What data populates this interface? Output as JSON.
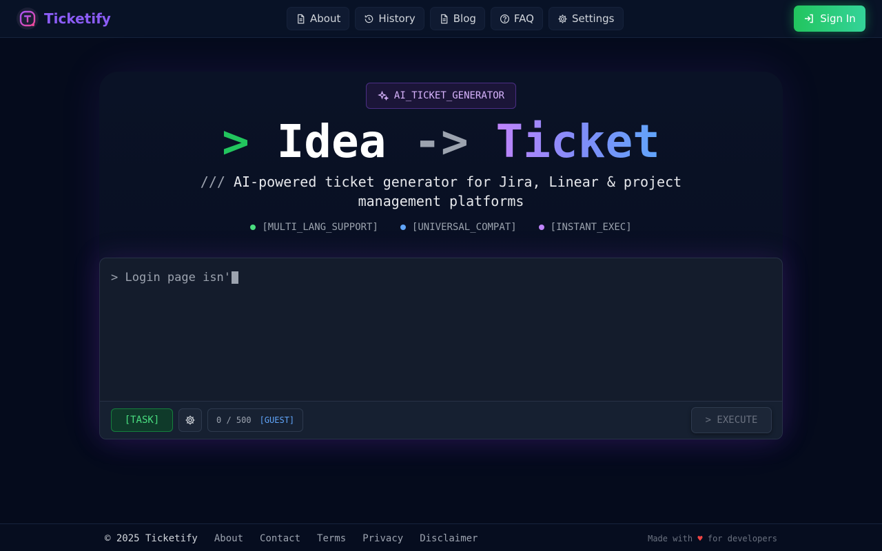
{
  "header": {
    "brand_name": "Ticketify",
    "nav": [
      {
        "label": "About",
        "icon": "file-icon"
      },
      {
        "label": "History",
        "icon": "history-icon"
      },
      {
        "label": "Blog",
        "icon": "file-icon"
      },
      {
        "label": "FAQ",
        "icon": "help-icon"
      },
      {
        "label": "Settings",
        "icon": "gear-icon"
      }
    ],
    "signin_label": "Sign In"
  },
  "hero": {
    "badge": "AI_TICKET_GENERATOR",
    "title_prompt": ">",
    "title_idea": "Idea",
    "title_arrow": "->",
    "title_ticket": "Ticket",
    "subtitle_prefix": "///",
    "subtitle": "AI-powered ticket generator for Jira, Linear & project management platforms",
    "features": [
      {
        "label": "[MULTI_LANG_SUPPORT]",
        "color": "#4ade80"
      },
      {
        "label": "[UNIVERSAL_COMPAT]",
        "color": "#60a5fa"
      },
      {
        "label": "[INSTANT_EXEC]",
        "color": "#c084fc"
      }
    ]
  },
  "editor": {
    "prompt": ">",
    "value": "Login page isn'",
    "task_label": "[TASK]",
    "counter": "0 / 500",
    "guest_label": "[GUEST]",
    "execute_label": "> EXECUTE"
  },
  "footer": {
    "copyright": "© 2025 Ticketify",
    "links": [
      "About",
      "Contact",
      "Terms",
      "Privacy",
      "Disclaimer"
    ],
    "made_with": "Made with",
    "heart": "♥",
    "for_devs": "for developers"
  },
  "colors": {
    "accent_green": "#22c55e",
    "accent_purple": "#8b5cf6",
    "background": "#050b1c"
  }
}
